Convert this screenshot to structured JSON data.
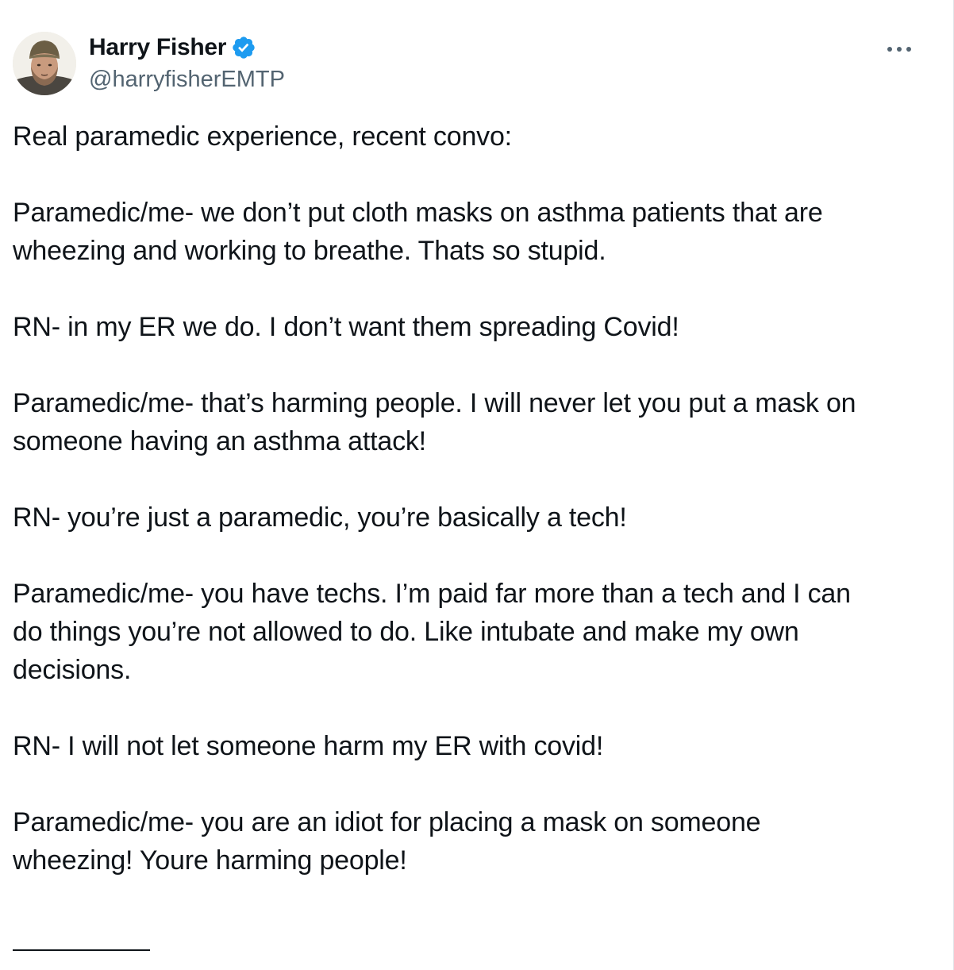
{
  "author": {
    "display_name": "Harry Fisher",
    "handle": "@harryfisherEMTP",
    "verified": true,
    "verified_color": "#1d9bf0",
    "avatar_icon": "profile-photo"
  },
  "more_icon": "more-horizontal-icon",
  "tweet": {
    "paragraphs": [
      "Real paramedic experience, recent convo:",
      "Paramedic/me- we don’t put cloth masks on asthma patients that are\nwheezing and working to breathe. Thats so stupid.",
      "RN- in my ER we do. I don’t want them spreading Covid!",
      "Paramedic/me- that’s harming people. I will never let you put a mask on\nsomeone having an asthma attack!",
      "RN- you’re just a paramedic, you’re basically a tech!",
      "Paramedic/me- you have techs. I’m paid far more than a tech and I can\ndo things you’re not allowed to do. Like intubate and make my own\ndecisions.",
      "RN- I will not let someone harm my ER with covid!",
      "Paramedic/me- you are an idiot for placing a mask on someone\nwheezing! Youre harming people!"
    ]
  },
  "colors": {
    "text_primary": "#0f1419",
    "text_secondary": "#536471",
    "background": "#ffffff"
  }
}
